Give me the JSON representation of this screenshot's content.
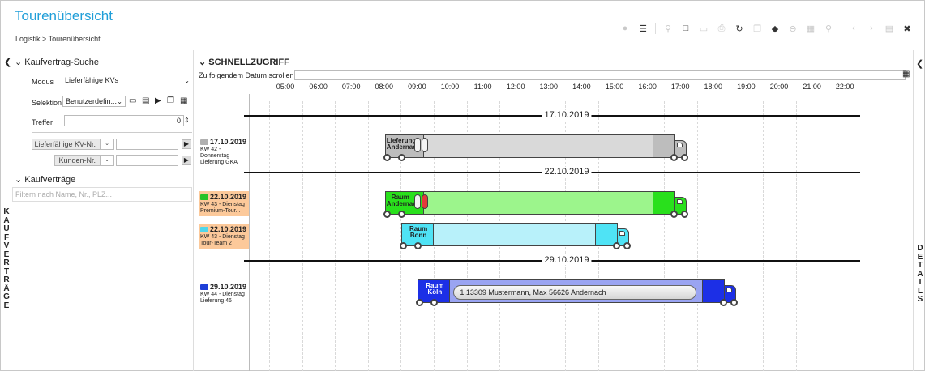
{
  "header": {
    "title": "Tourenübersicht",
    "breadcrumb": "Logistik > Tourenübersicht"
  },
  "toolbar": {
    "icons": [
      "comment-icon",
      "list-icon",
      "pin-icon",
      "new-document-icon",
      "folder-icon",
      "print-icon",
      "refresh-icon",
      "copy-icon",
      "tag-icon",
      "minus-circle-icon",
      "delete-icon",
      "search-icon",
      "prev-icon",
      "next-icon",
      "save-icon",
      "close-icon"
    ]
  },
  "left_panel": {
    "vertical_label": "KAUFVERTRÄGE",
    "search_section": "Kaufvertrag-Suche",
    "modus_label": "Modus",
    "modus_value": "Lieferfähige KVs",
    "selektion_label": "Selektion",
    "selektion_value": "Benutzerdefin...",
    "treffer_label": "Treffer",
    "treffer_value": "0",
    "filter1_label": "Lieferfähige KV-Nr.",
    "filter2_label": "Kunden-Nr.",
    "contracts_section": "Kaufverträge",
    "filter_placeholder": "Filtern nach Name, Nr., PLZ..."
  },
  "main": {
    "section_title": "SCHNELLZUGRIFF",
    "scroll_label": "Zu folgendem Datum scrollen:",
    "hours": [
      "05:00",
      "06:00",
      "07:00",
      "08:00",
      "09:00",
      "10:00",
      "11:00",
      "12:00",
      "13:00",
      "14:00",
      "15:00",
      "16:00",
      "17:00",
      "18:00",
      "19:00",
      "20:00",
      "21:00",
      "22:00"
    ],
    "date_separators": [
      "17.10.2019",
      "22.10.2019",
      "29.10.2019"
    ],
    "tours": [
      {
        "date": "17.10.2019",
        "line1": "KW 42 - Donnerstag",
        "line2": "Lieferung GKA",
        "icon_color": "#b0b0b0",
        "highlight": false
      },
      {
        "date": "22.10.2019",
        "line1": "KW 43 - Dienstag",
        "line2": "Premium-Tour...",
        "icon_color": "#27c227",
        "highlight": true
      },
      {
        "date": "22.10.2019",
        "line1": "KW 43 - Dienstag",
        "line2": "Tour-Team 2",
        "icon_color": "#4fd6ea",
        "highlight": true
      },
      {
        "date": "29.10.2019",
        "line1": "KW 44 - Dienstag",
        "line2": "Lieferung 46",
        "icon_color": "#1e3fd8",
        "highlight": false
      }
    ],
    "trucks": [
      {
        "label1": "Lieferung",
        "label2": "Andernac",
        "start": "08:00",
        "end": "17:00",
        "color": "#d9d9d9",
        "cab_color": "#bdbdbd"
      },
      {
        "label1": "Raum",
        "label2": "Andernac",
        "start": "08:00",
        "end": "17:00",
        "color": "#9cf58c",
        "cab_color": "#29e01c"
      },
      {
        "label1": "Raum",
        "label2": "Bonn",
        "start": "08:30",
        "end": "15:15",
        "color": "#b8f1fa",
        "cab_color": "#4fe3f5"
      },
      {
        "label1": "Raum",
        "label2": "Köln",
        "start": "09:00",
        "end": "18:30",
        "color": "#9aa4f2",
        "cab_color": "#1c2fe6",
        "order": "1,13309 Mustermann, Max 56626 Andernach"
      }
    ]
  },
  "right_panel": {
    "vertical_label": "DETAILS"
  },
  "colors": {
    "title_blue": "#1f9ed8",
    "highlight_orange": "#fcc99a"
  }
}
